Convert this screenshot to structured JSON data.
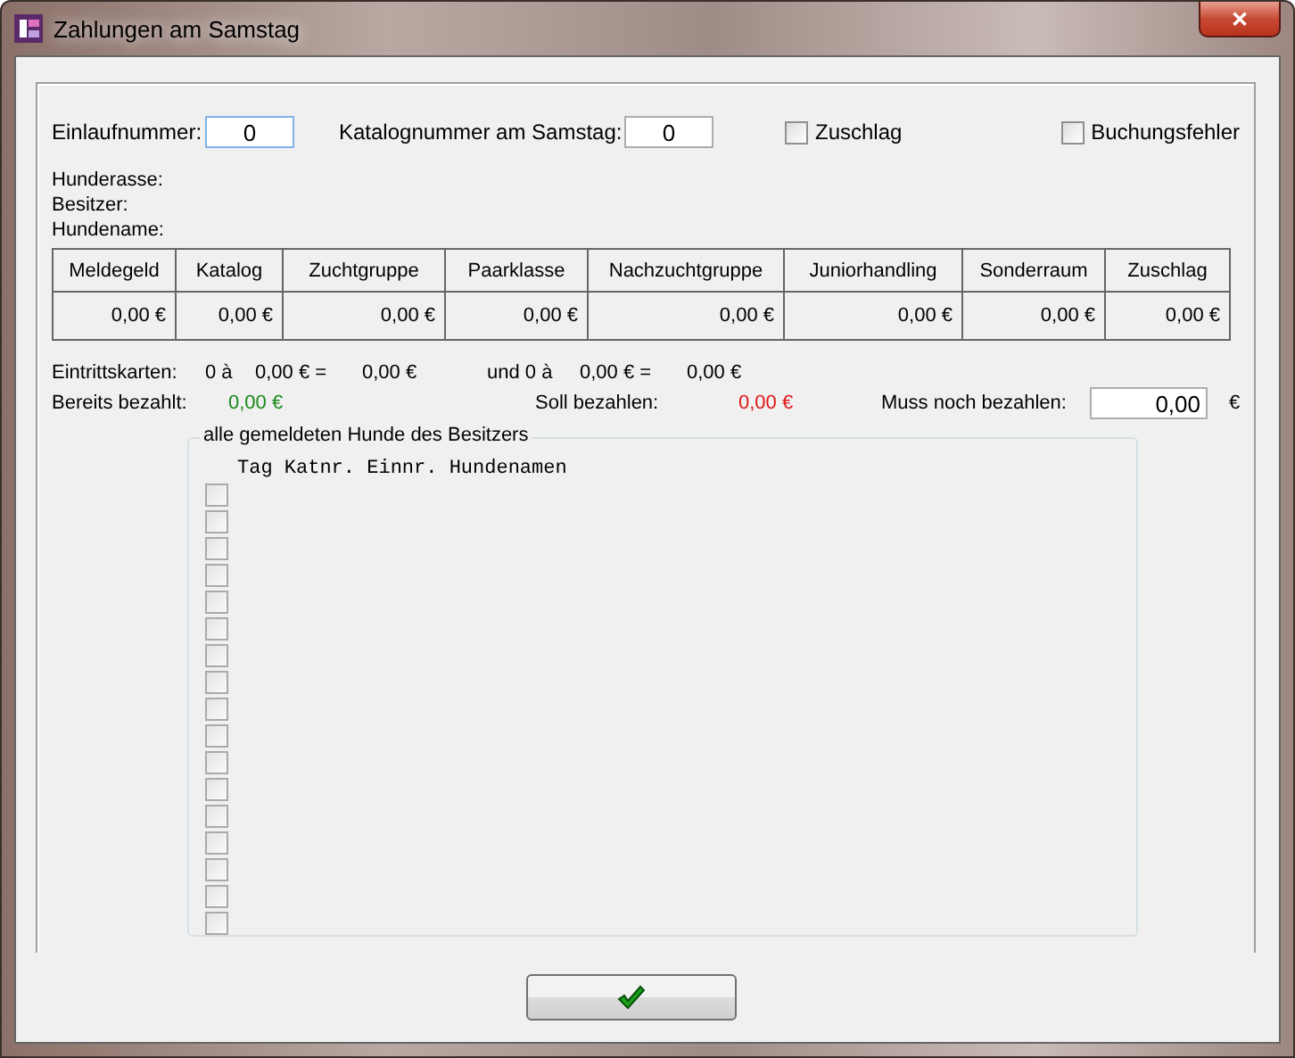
{
  "window": {
    "title": "Zahlungen am Samstag",
    "close": "✕"
  },
  "entry": {
    "einlauf_label": "Einlaufnummer:",
    "einlauf_value": "0",
    "katalog_label": "Katalognummer am Samstag:",
    "katalog_value": "0"
  },
  "checkboxes": [
    {
      "label": "Zuschlag",
      "checked": false
    },
    {
      "label": "Buchungsfehler",
      "checked": false
    }
  ],
  "info": [
    "Hunderasse:",
    "Besitzer:",
    "Hundename:"
  ],
  "table": {
    "columns": [
      "Meldegeld",
      "Katalog",
      "Zuchtgruppe",
      "Paarklasse",
      "Nachzuchtgruppe",
      "Juniorhandling",
      "Sonderraum",
      "Zuschlag"
    ],
    "values": [
      "0,00 €",
      "0,00 €",
      "0,00 €",
      "0,00 €",
      "0,00 €",
      "0,00 €",
      "0,00 €",
      "0,00 €"
    ]
  },
  "tickets": {
    "label": "Eintrittskarten:",
    "count_1": "0 à",
    "price_1": "0,00 € =",
    "sum_1": "0,00 €",
    "count_2": "und 0 à",
    "price_2": "0,00 € =",
    "sum_2": "0,00 €"
  },
  "payment": {
    "paid_label": "Bereits bezahlt:",
    "paid_value": "0,00 €",
    "due_label": "Soll bezahlen:",
    "due_value": "0,00 €",
    "owed_label": "Muss noch bezahlen:",
    "owed_value": "0,00",
    "owed_unit": "€"
  },
  "dogs": {
    "title": "alle gemeldeten Hunde des Besitzers",
    "header": "Tag Katnr. Einnr. Hundenamen",
    "items": [
      {
        "checked": false
      },
      {
        "checked": false
      },
      {
        "checked": false
      },
      {
        "checked": false
      },
      {
        "checked": false
      },
      {
        "checked": false
      },
      {
        "checked": false
      },
      {
        "checked": false
      },
      {
        "checked": false
      },
      {
        "checked": false
      },
      {
        "checked": false
      },
      {
        "checked": false
      },
      {
        "checked": false
      },
      {
        "checked": false
      },
      {
        "checked": false
      },
      {
        "checked": false
      },
      {
        "checked": false
      }
    ]
  }
}
